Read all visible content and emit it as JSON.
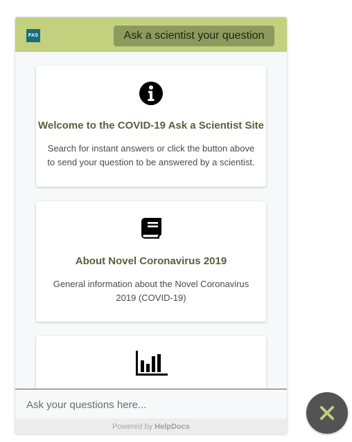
{
  "header": {
    "logo_text": "FAS",
    "ask_button_label": "Ask a scientist your question"
  },
  "cards": [
    {
      "icon": "info-circle-icon",
      "title": "Welcome to the COVID-19 Ask a Scientist Site",
      "description": "Search for instant answers or click the button above to send your question to be answered by a scientist."
    },
    {
      "icon": "book-icon",
      "title": "About Novel Coronavirus 2019",
      "description": "General information about the Novel Coronavirus 2019 (COVID-19)"
    },
    {
      "icon": "bar-chart-icon",
      "title": "",
      "description": ""
    }
  ],
  "input": {
    "placeholder": "Ask your questions here...",
    "value": ""
  },
  "footer": {
    "powered_prefix": "Powered by",
    "powered_brand": "HelpDocs"
  },
  "colors": {
    "header_bg": "#c3d07e",
    "ask_button_bg": "#8e9a5d",
    "card_title": "#5a5f3c",
    "logo_bg": "#1a6e7b",
    "fab_bg": "#535353",
    "fab_icon": "#c3d07e"
  },
  "close_button": {
    "icon": "close-x-icon"
  }
}
